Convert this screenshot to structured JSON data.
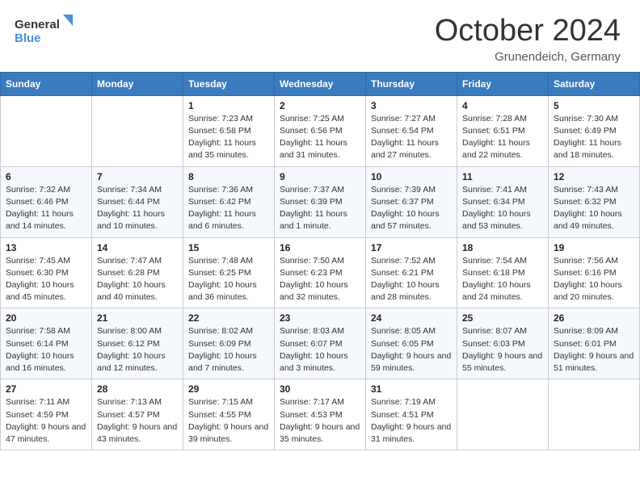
{
  "logo": {
    "line1": "General",
    "line2": "Blue"
  },
  "title": "October 2024",
  "subtitle": "Grunendeich, Germany",
  "days_of_week": [
    "Sunday",
    "Monday",
    "Tuesday",
    "Wednesday",
    "Thursday",
    "Friday",
    "Saturday"
  ],
  "weeks": [
    [
      {
        "day": "",
        "info": ""
      },
      {
        "day": "",
        "info": ""
      },
      {
        "day": "1",
        "info": "Sunrise: 7:23 AM\nSunset: 6:58 PM\nDaylight: 11 hours and 35 minutes."
      },
      {
        "day": "2",
        "info": "Sunrise: 7:25 AM\nSunset: 6:56 PM\nDaylight: 11 hours and 31 minutes."
      },
      {
        "day": "3",
        "info": "Sunrise: 7:27 AM\nSunset: 6:54 PM\nDaylight: 11 hours and 27 minutes."
      },
      {
        "day": "4",
        "info": "Sunrise: 7:28 AM\nSunset: 6:51 PM\nDaylight: 11 hours and 22 minutes."
      },
      {
        "day": "5",
        "info": "Sunrise: 7:30 AM\nSunset: 6:49 PM\nDaylight: 11 hours and 18 minutes."
      }
    ],
    [
      {
        "day": "6",
        "info": "Sunrise: 7:32 AM\nSunset: 6:46 PM\nDaylight: 11 hours and 14 minutes."
      },
      {
        "day": "7",
        "info": "Sunrise: 7:34 AM\nSunset: 6:44 PM\nDaylight: 11 hours and 10 minutes."
      },
      {
        "day": "8",
        "info": "Sunrise: 7:36 AM\nSunset: 6:42 PM\nDaylight: 11 hours and 6 minutes."
      },
      {
        "day": "9",
        "info": "Sunrise: 7:37 AM\nSunset: 6:39 PM\nDaylight: 11 hours and 1 minute."
      },
      {
        "day": "10",
        "info": "Sunrise: 7:39 AM\nSunset: 6:37 PM\nDaylight: 10 hours and 57 minutes."
      },
      {
        "day": "11",
        "info": "Sunrise: 7:41 AM\nSunset: 6:34 PM\nDaylight: 10 hours and 53 minutes."
      },
      {
        "day": "12",
        "info": "Sunrise: 7:43 AM\nSunset: 6:32 PM\nDaylight: 10 hours and 49 minutes."
      }
    ],
    [
      {
        "day": "13",
        "info": "Sunrise: 7:45 AM\nSunset: 6:30 PM\nDaylight: 10 hours and 45 minutes."
      },
      {
        "day": "14",
        "info": "Sunrise: 7:47 AM\nSunset: 6:28 PM\nDaylight: 10 hours and 40 minutes."
      },
      {
        "day": "15",
        "info": "Sunrise: 7:48 AM\nSunset: 6:25 PM\nDaylight: 10 hours and 36 minutes."
      },
      {
        "day": "16",
        "info": "Sunrise: 7:50 AM\nSunset: 6:23 PM\nDaylight: 10 hours and 32 minutes."
      },
      {
        "day": "17",
        "info": "Sunrise: 7:52 AM\nSunset: 6:21 PM\nDaylight: 10 hours and 28 minutes."
      },
      {
        "day": "18",
        "info": "Sunrise: 7:54 AM\nSunset: 6:18 PM\nDaylight: 10 hours and 24 minutes."
      },
      {
        "day": "19",
        "info": "Sunrise: 7:56 AM\nSunset: 6:16 PM\nDaylight: 10 hours and 20 minutes."
      }
    ],
    [
      {
        "day": "20",
        "info": "Sunrise: 7:58 AM\nSunset: 6:14 PM\nDaylight: 10 hours and 16 minutes."
      },
      {
        "day": "21",
        "info": "Sunrise: 8:00 AM\nSunset: 6:12 PM\nDaylight: 10 hours and 12 minutes."
      },
      {
        "day": "22",
        "info": "Sunrise: 8:02 AM\nSunset: 6:09 PM\nDaylight: 10 hours and 7 minutes."
      },
      {
        "day": "23",
        "info": "Sunrise: 8:03 AM\nSunset: 6:07 PM\nDaylight: 10 hours and 3 minutes."
      },
      {
        "day": "24",
        "info": "Sunrise: 8:05 AM\nSunset: 6:05 PM\nDaylight: 9 hours and 59 minutes."
      },
      {
        "day": "25",
        "info": "Sunrise: 8:07 AM\nSunset: 6:03 PM\nDaylight: 9 hours and 55 minutes."
      },
      {
        "day": "26",
        "info": "Sunrise: 8:09 AM\nSunset: 6:01 PM\nDaylight: 9 hours and 51 minutes."
      }
    ],
    [
      {
        "day": "27",
        "info": "Sunrise: 7:11 AM\nSunset: 4:59 PM\nDaylight: 9 hours and 47 minutes."
      },
      {
        "day": "28",
        "info": "Sunrise: 7:13 AM\nSunset: 4:57 PM\nDaylight: 9 hours and 43 minutes."
      },
      {
        "day": "29",
        "info": "Sunrise: 7:15 AM\nSunset: 4:55 PM\nDaylight: 9 hours and 39 minutes."
      },
      {
        "day": "30",
        "info": "Sunrise: 7:17 AM\nSunset: 4:53 PM\nDaylight: 9 hours and 35 minutes."
      },
      {
        "day": "31",
        "info": "Sunrise: 7:19 AM\nSunset: 4:51 PM\nDaylight: 9 hours and 31 minutes."
      },
      {
        "day": "",
        "info": ""
      },
      {
        "day": "",
        "info": ""
      }
    ]
  ]
}
